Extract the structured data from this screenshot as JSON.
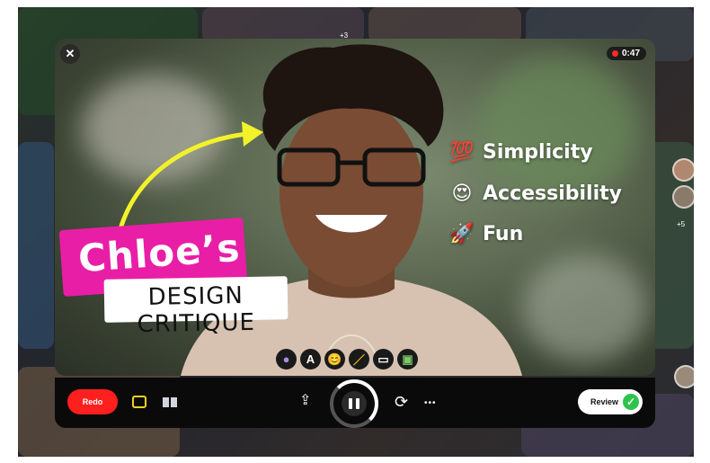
{
  "modal": {
    "close_icon": "✕",
    "timer": "0:47"
  },
  "overlay": {
    "name_label": "Chloe’s",
    "subtitle_label": "DESIGN CRITIQUE",
    "keywords": [
      {
        "emoji": "💯",
        "label": "Simplicity"
      },
      {
        "emoji": "😍",
        "label": "Accessibility"
      },
      {
        "emoji": "🚀",
        "label": "Fun"
      }
    ]
  },
  "tools": [
    {
      "name": "effects-tool-icon",
      "glyph": "●"
    },
    {
      "name": "text-tool-icon",
      "glyph": "A"
    },
    {
      "name": "emoji-tool-icon",
      "glyph": "😊"
    },
    {
      "name": "pen-tool-icon",
      "glyph": "／"
    },
    {
      "name": "board-tool-icon",
      "glyph": "▭"
    },
    {
      "name": "image-tool-icon",
      "glyph": "▣"
    }
  ],
  "controls": {
    "redo_label": "Redo",
    "review_label": "Review",
    "review_check": "✓",
    "more_glyph": "•••",
    "flip_glyph": "⟳",
    "upload_glyph": "⇪"
  },
  "background": {
    "side_badge_1": "+3",
    "side_badge_2": "+5"
  },
  "colors": {
    "redo": "#ff1f1f",
    "review_check": "#2ec44b",
    "name_banner": "#e91ea6",
    "arrow": "#f2f22a"
  }
}
